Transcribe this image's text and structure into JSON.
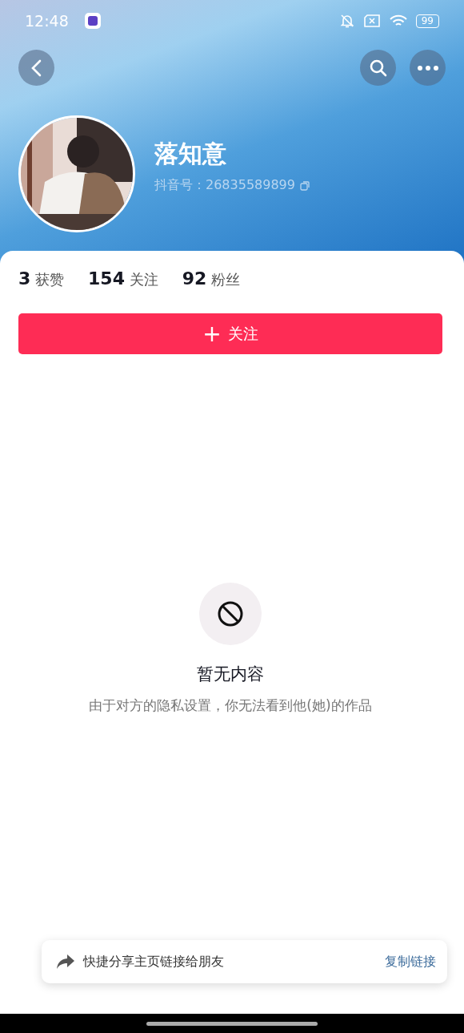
{
  "status_bar": {
    "time": "12:48",
    "battery": "99"
  },
  "profile": {
    "name": "落知意",
    "id_label": "抖音号：",
    "id": "26835589899"
  },
  "stats": [
    "**3** 获赞",
    "**154** 关注",
    "**92** 粉丝"
  ],
  "follow_button": {
    "icon": "+",
    "label": "关注"
  },
  "empty_state": {
    "title": "暂无内容",
    "message": "由于对方的隐私设置，你无法看到他(她)的作品"
  },
  "share_bar": {
    "text": "快捷分享主页链接给朋友",
    "action": "复制链接"
  }
}
